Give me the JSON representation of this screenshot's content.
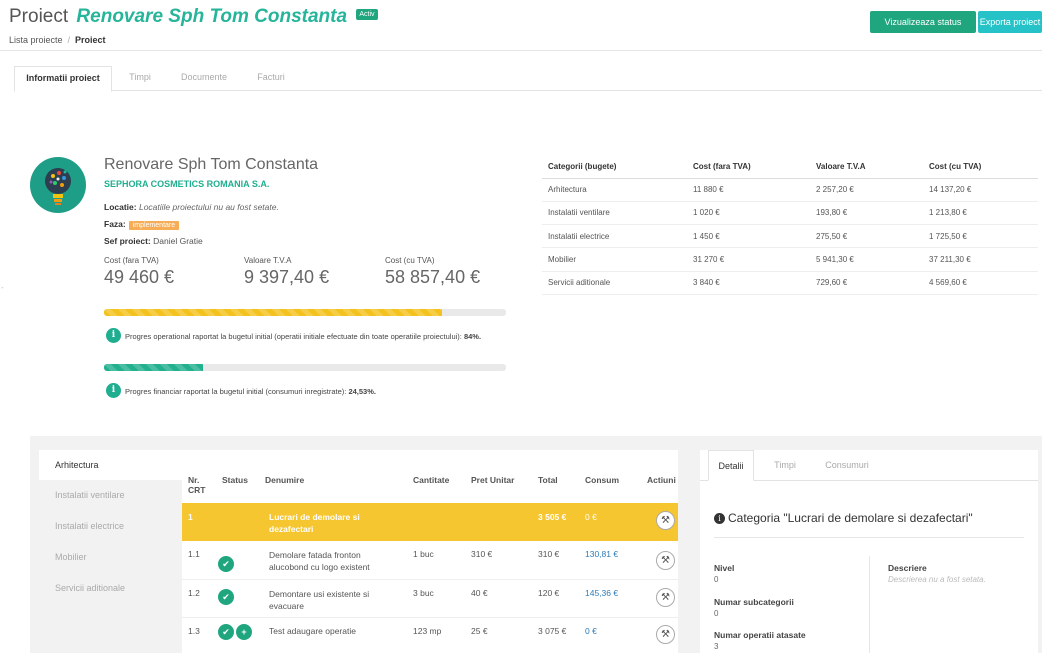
{
  "header": {
    "title_prefix": "Proiect",
    "project_name": "Renovare Sph Tom Constanta",
    "status_badge": "Activ",
    "breadcrumb": {
      "parent": "Lista proiecte",
      "separator": "/",
      "current": "Proiect"
    },
    "btn_status": "Vizualizeaza status proiect",
    "btn_export": "Exporta proiect"
  },
  "tabs": [
    "Informatii proiect",
    "Timpi",
    "Documente",
    "Facturi"
  ],
  "project": {
    "name": "Renovare Sph Tom Constanta",
    "company": "SEPHORA COSMETICS ROMANIA S.A.",
    "location_label": "Locatie:",
    "location_value": "Locatiile proiectului nu au fost setate.",
    "phase_label": "Faza:",
    "phase_value": "implementare",
    "manager_label": "Sef proiect:",
    "manager_value": "Daniel Gratie",
    "cost_fara_tva_label": "Cost (fara TVA)",
    "cost_fara_tva": "49 460 €",
    "valoare_tva_label": "Valoare T.V.A",
    "valoare_tva": "9 397,40 €",
    "cost_cu_tva_label": "Cost (cu TVA)",
    "cost_cu_tva": "58 857,40 €",
    "progress_operational_text": "Progres operational raportat la bugetul initial (operatii initiale efectuate din toate operatiile proiectului):",
    "progress_operational_value": "84%.",
    "progress_operational_fraction": 0.84,
    "progress_financial_text": "Progres financiar raportat la bugetul initial (consumuri inregistrate):",
    "progress_financial_value": "24,53%.",
    "progress_financial_fraction": 0.2453
  },
  "budget_table": {
    "headers": [
      "Categorii (bugete)",
      "Cost (fara TVA)",
      "Valoare T.V.A",
      "Cost (cu TVA)"
    ],
    "rows": [
      [
        "Arhitectura",
        "11 880 €",
        "2 257,20 €",
        "14 137,20 €"
      ],
      [
        "Instalatii ventilare",
        "1 020 €",
        "193,80 €",
        "1 213,80 €"
      ],
      [
        "Instalatii electrice",
        "1 450 €",
        "275,50 €",
        "1 725,50 €"
      ],
      [
        "Mobilier",
        "31 270 €",
        "5 941,30 €",
        "37 211,30 €"
      ],
      [
        "Servicii aditionale",
        "3 840 €",
        "729,60 €",
        "4 569,60 €"
      ]
    ]
  },
  "categories_nav": [
    "Arhitectura",
    "Instalatii ventilare",
    "Instalatii electrice",
    "Mobilier",
    "Servicii aditionale"
  ],
  "ops_table": {
    "headers": [
      "Nr. CRT",
      "Status",
      "Denumire",
      "Cantitate",
      "Pret Unitar",
      "Total",
      "Consum",
      "Actiuni"
    ],
    "group": {
      "nr": "1",
      "denumire": "Lucrari de demolare si dezafectari",
      "total": "3 505 €",
      "consum": "0 €"
    },
    "rows": [
      {
        "nr": "1.1",
        "denumire": "Demolare fatada fronton alucobond cu logo existent",
        "cantitate": "1 buc",
        "pret": "310 €",
        "total": "310 €",
        "consum": "130,81 €"
      },
      {
        "nr": "1.2",
        "denumire": "Demontare usi existente si evacuare",
        "cantitate": "3 buc",
        "pret": "40 €",
        "total": "120 €",
        "consum": "145,36 €"
      },
      {
        "nr": "1.3",
        "denumire": "Test adaugare operatie",
        "cantitate": "123 mp",
        "pret": "25 €",
        "total": "3 075 €",
        "consum": "0 €"
      }
    ]
  },
  "details": {
    "tabs": [
      "Detalii",
      "Timpi",
      "Consumuri"
    ],
    "heading": "Categoria \"Lucrari de demolare si dezafectari\"",
    "nivel_label": "Nivel",
    "nivel_value": "0",
    "subcat_label": "Numar subcategorii",
    "subcat_value": "0",
    "ops_label": "Numar operatii atasate",
    "ops_value": "3",
    "desc_label": "Descriere",
    "desc_value": "Descrierea nu a fost setata."
  },
  "colors": {
    "accent": "#26b59a",
    "group_row": "#f6c630",
    "badge": "#f6ad55",
    "link": "#2b7bb9"
  }
}
